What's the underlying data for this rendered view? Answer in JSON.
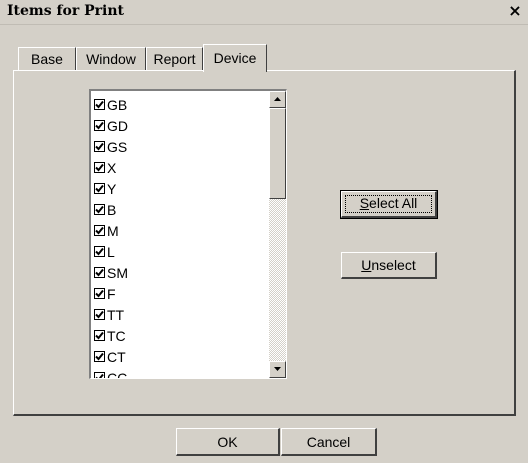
{
  "window": {
    "title": "Items for Print",
    "close_glyph": "×"
  },
  "tabs": [
    {
      "label": "Base",
      "active": false
    },
    {
      "label": "Window",
      "active": false
    },
    {
      "label": "Report",
      "active": false
    },
    {
      "label": "Device",
      "active": true
    }
  ],
  "items": [
    {
      "label": "GB",
      "checked": true
    },
    {
      "label": "GD",
      "checked": true
    },
    {
      "label": "GS",
      "checked": true
    },
    {
      "label": "X",
      "checked": true
    },
    {
      "label": "Y",
      "checked": true
    },
    {
      "label": "B",
      "checked": true
    },
    {
      "label": "M",
      "checked": true
    },
    {
      "label": "L",
      "checked": true
    },
    {
      "label": "SM",
      "checked": true
    },
    {
      "label": "F",
      "checked": true
    },
    {
      "label": "TT",
      "checked": true
    },
    {
      "label": "TC",
      "checked": true
    },
    {
      "label": "CT",
      "checked": true
    },
    {
      "label": "CC",
      "checked": true
    }
  ],
  "buttons": {
    "select_all_mnemonic": "S",
    "select_all_rest": "elect All",
    "unselect_mnemonic": "U",
    "unselect_rest": "nselect",
    "ok": "OK",
    "cancel": "Cancel"
  },
  "icons": {
    "check": "check-icon",
    "scroll_up": "arrow-up-icon",
    "scroll_down": "arrow-down-icon",
    "close": "close-icon"
  }
}
